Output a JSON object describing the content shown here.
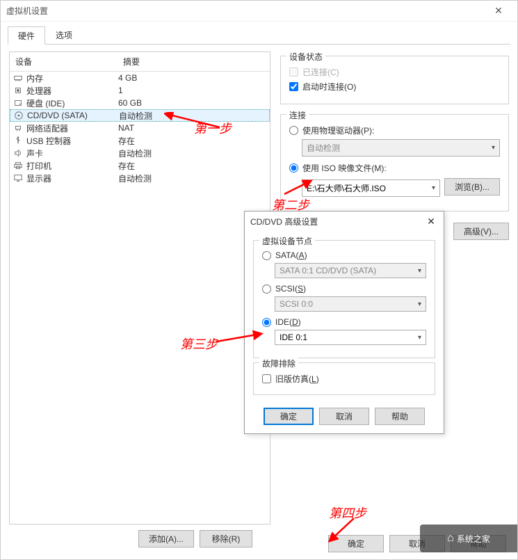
{
  "window": {
    "title": "虚拟机设置"
  },
  "tabs": {
    "hardware": "硬件",
    "options": "选项"
  },
  "table": {
    "header_device": "设备",
    "header_summary": "摘要",
    "rows": [
      {
        "icon": "memory",
        "name": "内存",
        "summary": "4 GB"
      },
      {
        "icon": "cpu",
        "name": "处理器",
        "summary": "1"
      },
      {
        "icon": "disk",
        "name": "硬盘 (IDE)",
        "summary": "60 GB"
      },
      {
        "icon": "cd",
        "name": "CD/DVD (SATA)",
        "summary": "自动检测",
        "selected": true
      },
      {
        "icon": "net",
        "name": "网络适配器",
        "summary": "NAT"
      },
      {
        "icon": "usb",
        "name": "USB 控制器",
        "summary": "存在"
      },
      {
        "icon": "sound",
        "name": "声卡",
        "summary": "自动检测"
      },
      {
        "icon": "printer",
        "name": "打印机",
        "summary": "存在"
      },
      {
        "icon": "display",
        "name": "显示器",
        "summary": "自动检测"
      }
    ]
  },
  "left_buttons": {
    "add": "添加(A)...",
    "remove": "移除(R)"
  },
  "status": {
    "group": "设备状态",
    "connected": "已连接(C)",
    "connect_on": "启动时连接(O)"
  },
  "connection": {
    "group": "连接",
    "physical": "使用物理驱动器(P):",
    "physical_combo": "自动检测",
    "iso_label": "使用 ISO 映像文件(M):",
    "iso_path": "E:\\石大师\\石大师.ISO",
    "browse": "浏览(B)..."
  },
  "advanced_btn": "高级(V)...",
  "modal": {
    "title": "CD/DVD 高级设置",
    "node_group": "虚拟设备节点",
    "sata_label": "SATA(A)",
    "sata_combo": "SATA 0:1   CD/DVD (SATA)",
    "scsi_label": "SCSI(S)",
    "scsi_combo": "SCSI 0:0",
    "ide_label": "IDE(D)",
    "ide_combo": "IDE 0:1",
    "troubleshoot_group": "故障排除",
    "legacy": "旧版仿真(L)",
    "ok": "确定",
    "cancel": "取消",
    "help": "帮助"
  },
  "footer": {
    "ok": "确定",
    "cancel": "取消",
    "help": "帮助"
  },
  "annotations": {
    "step1": "第一步",
    "step2": "第二步",
    "step3": "第三步",
    "step4": "第四步"
  },
  "watermark": "系统之家"
}
